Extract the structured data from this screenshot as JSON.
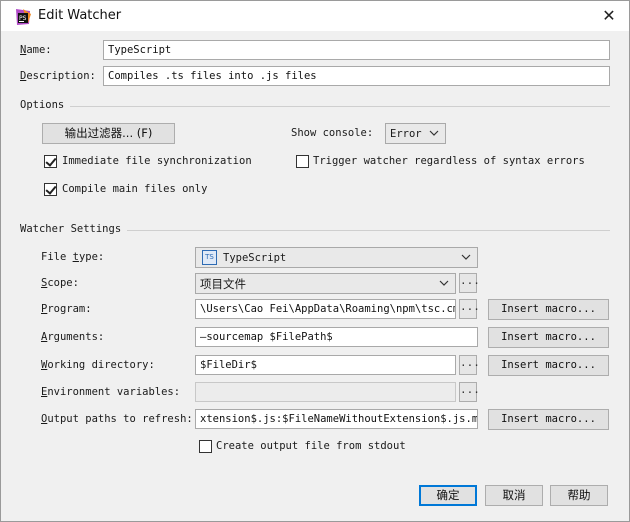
{
  "dialog": {
    "title": "Edit Watcher",
    "close_glyph": "✕"
  },
  "name_row": {
    "label_u": "N",
    "label_rest": "ame:",
    "value": "TypeScript"
  },
  "description_row": {
    "label_u": "D",
    "label_rest": "escription:",
    "value": "Compiles .ts files into .js files"
  },
  "options": {
    "section_title": "Options",
    "output_filters_button": "输出过滤器... (F)",
    "show_console_label": "Show console:",
    "show_console_value": "Error",
    "immediate_sync": {
      "label": "Immediate file synchronization",
      "checked": true
    },
    "trigger_watcher": {
      "label": "Trigger watcher regardless of syntax errors",
      "checked": false
    },
    "compile_main": {
      "label": "Compile main files only",
      "checked": true
    }
  },
  "watcher_settings": {
    "section_title": "Watcher Settings",
    "file_type": {
      "label_pre": "File ",
      "label_u": "t",
      "label_rest": "ype:",
      "value": "TypeScript",
      "icon_text": "TS"
    },
    "scope": {
      "label_u": "S",
      "label_rest": "cope:",
      "value": "项目文件"
    },
    "program": {
      "label_u": "P",
      "label_rest": "rogram:",
      "value": "\\Users\\Cao Fei\\AppData\\Roaming\\npm\\tsc.cmd"
    },
    "arguments": {
      "label_u": "A",
      "label_rest": "rguments:",
      "value": "—sourcemap $FilePath$"
    },
    "working_directory": {
      "label_u": "W",
      "label_rest": "orking directory:",
      "value": "$FileDir$"
    },
    "environment_variables": {
      "label_u": "E",
      "label_rest": "nvironment variables:",
      "value": ""
    },
    "output_paths": {
      "label_u": "O",
      "label_rest": "utput paths to refresh:",
      "value": "xtension$.js:$FileNameWithoutExtension$.js.map"
    },
    "create_output": {
      "label": "Create output file from stdout",
      "checked": false
    },
    "insert_macro_label": "Insert macro...",
    "ellipsis": "..."
  },
  "footer": {
    "ok": "确定",
    "cancel": "取消",
    "help": "帮助"
  },
  "colors": {
    "accent": "#0078d7",
    "dialog_bg": "#f0f0f0"
  }
}
